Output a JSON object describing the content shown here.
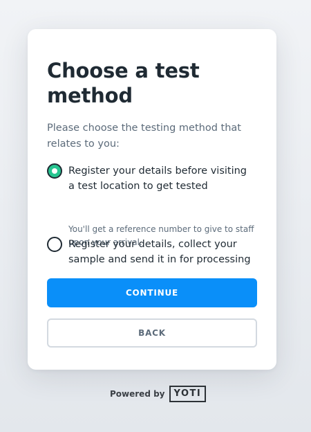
{
  "card": {
    "title": "Choose a test method",
    "intro": "Please choose the testing method that relates to you:"
  },
  "options": [
    {
      "label": "Register your details before visiting a test location to get tested",
      "hint": "You'll get a reference number to give to staff upon your arrival.",
      "selected": true
    },
    {
      "label": "Register your details, collect your sample and send it in for processing",
      "selected": false
    }
  ],
  "buttons": {
    "continue": "CONTINUE",
    "back": "BACK"
  },
  "footer": {
    "powered_by": "Powered by",
    "brand": "YOTI"
  },
  "colors": {
    "accent": "#0a8ff9",
    "radio_selected": "#27c590",
    "text": "#1f2a33",
    "muted": "#5c6b7a"
  }
}
